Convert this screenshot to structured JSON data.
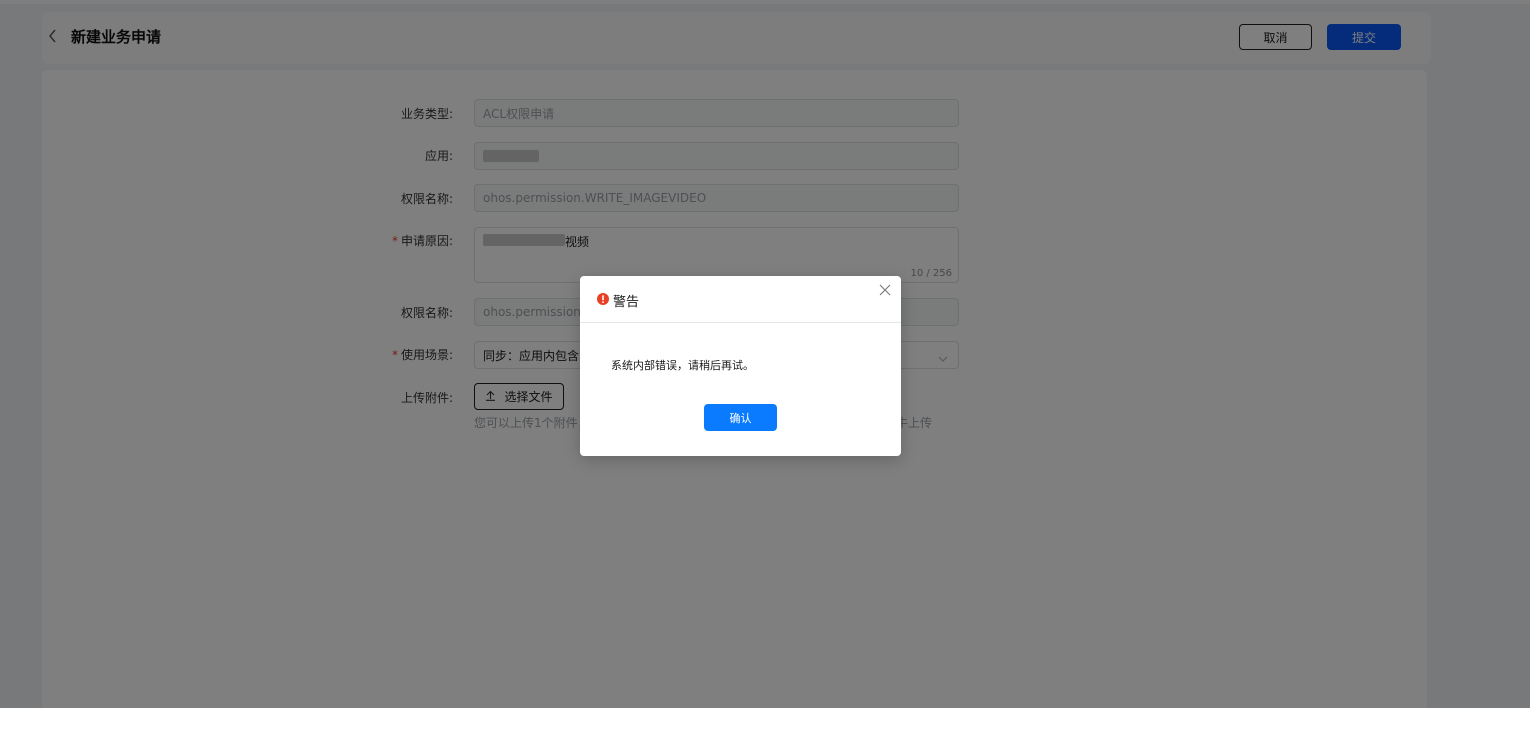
{
  "header": {
    "title": "新建业务申请",
    "cancel_label": "取消",
    "submit_label": "提交"
  },
  "form": {
    "business_type": {
      "label": "业务类型:",
      "value": "ACL权限申请"
    },
    "application": {
      "label": "应用:",
      "value": ""
    },
    "permission_name_1": {
      "label": "权限名称:",
      "value": "ohos.permission.WRITE_IMAGEVIDEO"
    },
    "reason": {
      "label": "申请原因:",
      "value_suffix": "视频",
      "counter": "10 / 256"
    },
    "permission_name_2": {
      "label": "权限名称:",
      "value": "ohos.permission.RE"
    },
    "usage_scenario": {
      "label": "使用场景:",
      "value": "同步：应用内包含图"
    },
    "attachment": {
      "label": "上传附件:",
      "button_label": "选择文件",
      "hint": "您可以上传1个附件，耳",
      "hint_tail": "牛上传"
    }
  },
  "dialog": {
    "title": "警告",
    "message": "系统内部错误，请稍后再试。",
    "confirm_label": "确认"
  },
  "icons": {
    "back": "chevron-left-icon",
    "warning": "warning-circle-icon",
    "close": "close-icon",
    "upload": "upload-icon",
    "dropdown": "chevron-down-icon"
  },
  "colors": {
    "primary": "#0a59f7",
    "dialog_confirm": "#0a7bff",
    "warning": "#e84026",
    "required": "#e84026"
  }
}
